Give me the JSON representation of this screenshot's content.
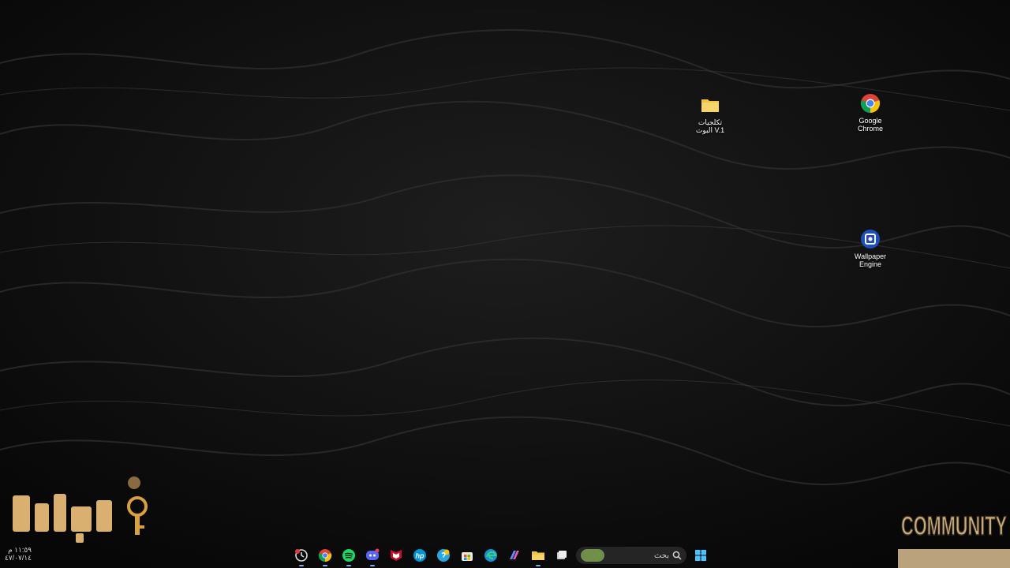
{
  "desktop": {
    "icons": [
      {
        "name": "folder",
        "label": "تكلجيات\nالبوت V.1"
      },
      {
        "name": "google-chrome",
        "label": "Google\nChrome"
      },
      {
        "name": "wallpaper-engine",
        "label": "Wallpaper\nEngine"
      }
    ]
  },
  "branding": {
    "logo_left_icon": "key-logo",
    "logo_right_text": "COMMUNITY"
  },
  "clock": {
    "time": "١١:٥٩ م",
    "date": "٤٧/٠٧/١٤"
  },
  "taskbar": {
    "search_placeholder": "بحث",
    "apps": [
      {
        "name": "screen-recorder-icon"
      },
      {
        "name": "chrome-icon"
      },
      {
        "name": "spotify-icon"
      },
      {
        "name": "discord-icon"
      },
      {
        "name": "mcafee-icon"
      },
      {
        "name": "hp-icon"
      },
      {
        "name": "support-icon"
      },
      {
        "name": "store-icon"
      },
      {
        "name": "edge-icon"
      },
      {
        "name": "copilot-icon"
      },
      {
        "name": "file-explorer-icon"
      },
      {
        "name": "task-view-icon"
      }
    ],
    "start_icon": "windows-start-icon"
  },
  "colors": {
    "accent": "#7aaee8",
    "folder": "#f2c440",
    "logo": "#d9b070"
  }
}
